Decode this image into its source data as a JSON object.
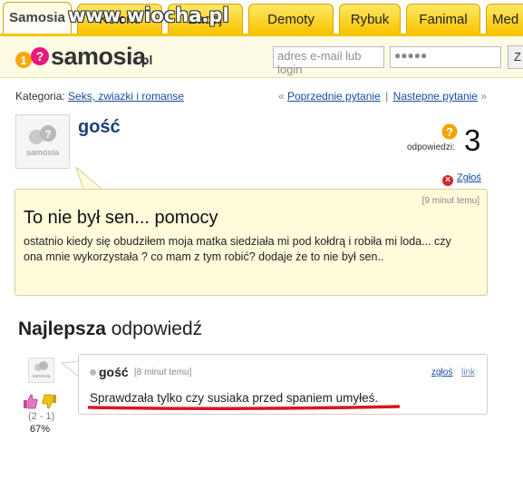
{
  "tabs": [
    {
      "label": "Samosia",
      "active": true
    },
    {
      "label": "Kolorki",
      "active": false
    },
    {
      "label": "Zadaj",
      "active": false
    },
    {
      "label": "Demoty",
      "active": false
    },
    {
      "label": "Rybuk",
      "active": false
    },
    {
      "label": "Fanimal",
      "active": false
    },
    {
      "label": "Med",
      "active": false
    }
  ],
  "watermark": "www.wiocha.pl",
  "header": {
    "logo_text": "samosia",
    "logo_suffix": ".pl",
    "email_placeholder": "adres e-mail lub login",
    "password_mask": "●●●●●",
    "login_button": "Z"
  },
  "category": {
    "label": "Kategoria:",
    "value": "Seks, zwiazki i romanse"
  },
  "nav": {
    "prev_marker": "«",
    "prev": "Poprzednie pytanie",
    "divider": "|",
    "next": "Nastepne pytanie",
    "next_marker": "»"
  },
  "question": {
    "author": "gość",
    "answers_label": "odpowiedzi:",
    "answers_count": "3",
    "report_label": "Zgłoś",
    "time": "[9 minut temu]",
    "title": "To nie był sen... pomocy",
    "body": "ostatnio kiedy się obudziłem moja matka siedziała mi pod kołdrą i robiła mi loda... czy ona mnie wykorzystała ? co mam z tym robić? dodaje że to nie był sen.."
  },
  "best_answer": {
    "heading_bold": "Najlepsza",
    "heading_rest": "odpowiedź",
    "author": "gość",
    "time": "[8 minut temu]",
    "report_label": "zgłoś",
    "link_label": "link",
    "text": "Sprawdzała tylko czy susiaka przed spaniem umyłeś.",
    "votes": "(2 - 1)",
    "percent": "67%"
  },
  "colors": {
    "tab_yellow": "#f7c400",
    "link_blue": "#1a4ba0",
    "highlight_red": "#d9151f",
    "question_bg": "#fffbdb"
  }
}
